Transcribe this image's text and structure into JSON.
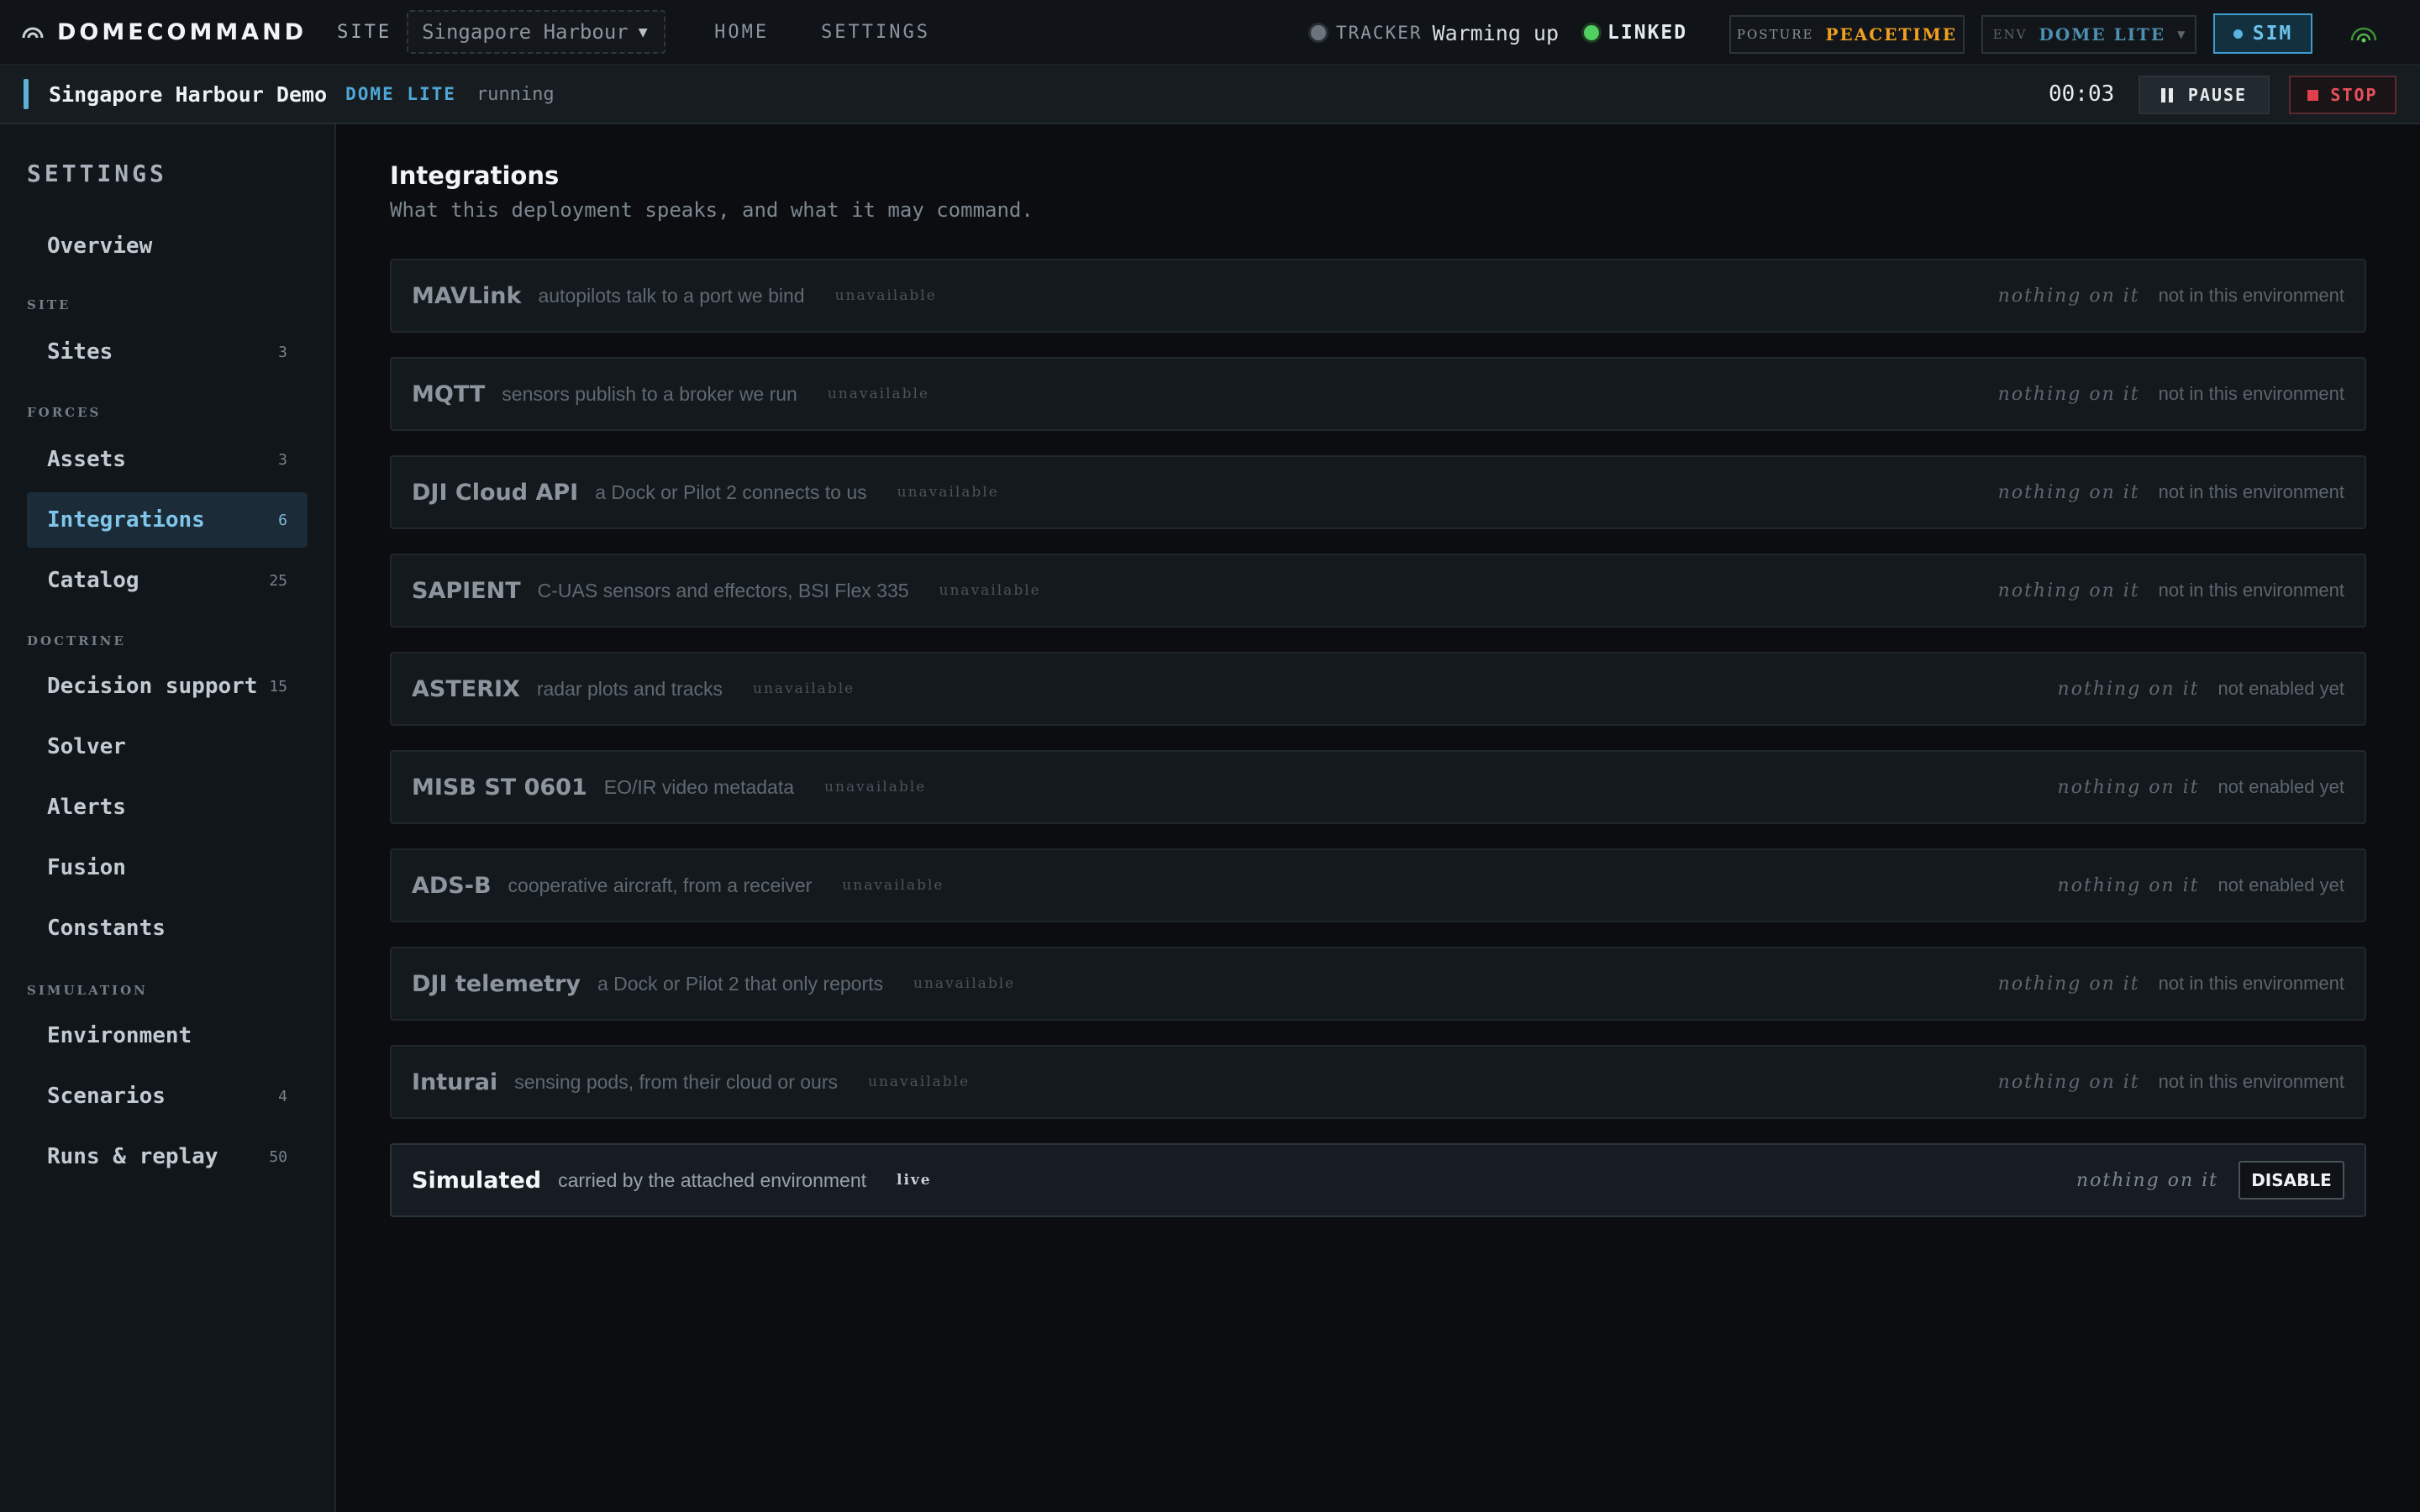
{
  "topbar": {
    "brand": "DOMECOMMAND",
    "site_label": "SITE",
    "site_value": "Singapore Harbour",
    "nav": {
      "home": "HOME",
      "settings": "SETTINGS"
    },
    "tracker_label": "TRACKER",
    "tracker_status": "Warming up",
    "linked": "LINKED",
    "posture_label": "POSTURE",
    "posture_value": "PEACETIME",
    "env_label": "ENV",
    "env_value": "DOME LITE",
    "sim": "SIM"
  },
  "runbar": {
    "name": "Singapore Harbour Demo",
    "env": "DOME LITE",
    "state": "running",
    "timer": "00:03",
    "pause": "PAUSE",
    "stop": "STOP"
  },
  "sidebar": {
    "title": "SETTINGS",
    "overview": "Overview",
    "groups": {
      "site": "SITE",
      "forces": "FORCES",
      "doctrine": "DOCTRINE",
      "simulation": "SIMULATION"
    },
    "items": [
      {
        "label": "Sites",
        "count": "3"
      },
      {
        "label": "Assets",
        "count": "3"
      },
      {
        "label": "Integrations",
        "count": "6"
      },
      {
        "label": "Catalog",
        "count": "25"
      },
      {
        "label": "Decision support",
        "count": "15"
      },
      {
        "label": "Solver",
        "count": ""
      },
      {
        "label": "Alerts",
        "count": ""
      },
      {
        "label": "Fusion",
        "count": ""
      },
      {
        "label": "Constants",
        "count": ""
      },
      {
        "label": "Environment",
        "count": ""
      },
      {
        "label": "Scenarios",
        "count": "4"
      },
      {
        "label": "Runs & replay",
        "count": "50"
      }
    ]
  },
  "main": {
    "title": "Integrations",
    "subtitle": "What this deployment speaks, and what it may command.",
    "integrations": [
      {
        "name": "MAVLink",
        "desc": "autopilots talk to a port we bind",
        "status": "unavailable",
        "nothing": "nothing on it",
        "note": "not in this environment"
      },
      {
        "name": "MQTT",
        "desc": "sensors publish to a broker we run",
        "status": "unavailable",
        "nothing": "nothing on it",
        "note": "not in this environment"
      },
      {
        "name": "DJI Cloud API",
        "desc": "a Dock or Pilot 2 connects to us",
        "status": "unavailable",
        "nothing": "nothing on it",
        "note": "not in this environment"
      },
      {
        "name": "SAPIENT",
        "desc": "C-UAS sensors and effectors, BSI Flex 335",
        "status": "unavailable",
        "nothing": "nothing on it",
        "note": "not in this environment"
      },
      {
        "name": "ASTERIX",
        "desc": "radar plots and tracks",
        "status": "unavailable",
        "nothing": "nothing on it",
        "note": "not enabled yet"
      },
      {
        "name": "MISB ST 0601",
        "desc": "EO/IR video metadata",
        "status": "unavailable",
        "nothing": "nothing on it",
        "note": "not enabled yet"
      },
      {
        "name": "ADS-B",
        "desc": "cooperative aircraft, from a receiver",
        "status": "unavailable",
        "nothing": "nothing on it",
        "note": "not enabled yet"
      },
      {
        "name": "DJI telemetry",
        "desc": "a Dock or Pilot 2 that only reports",
        "status": "unavailable",
        "nothing": "nothing on it",
        "note": "not in this environment"
      },
      {
        "name": "Inturai",
        "desc": "sensing pods, from their cloud or ours",
        "status": "unavailable",
        "nothing": "nothing on it",
        "note": "not in this environment"
      },
      {
        "name": "Simulated",
        "desc": "carried by the attached environment",
        "status": "live",
        "nothing": "nothing on it",
        "action": "DISABLE"
      }
    ]
  }
}
